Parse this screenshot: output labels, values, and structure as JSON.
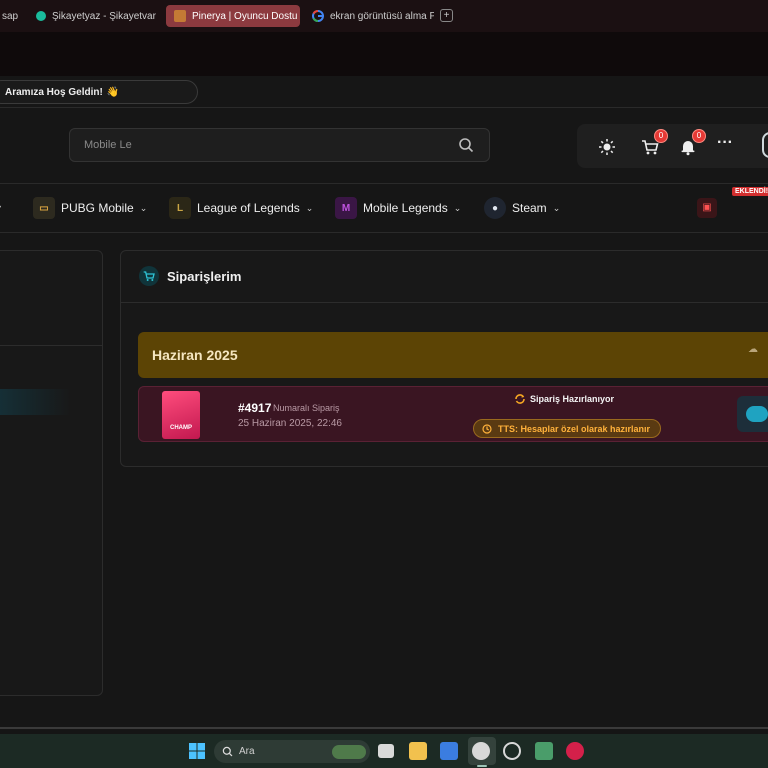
{
  "browser": {
    "tabs": [
      {
        "label": "sap"
      },
      {
        "label": "Şikayetyaz - Şikayetvar"
      },
      {
        "label": "Pinerya | Oyuncu Dostu",
        "active": true
      },
      {
        "label": "ekran görüntüsü alma PC"
      }
    ],
    "new_tab": "+"
  },
  "header": {
    "announcement": "Aramıza Hoş Geldin!",
    "announcement_emoji": "👋",
    "search_value": "Mobile Le",
    "cart_count": "0",
    "notification_count": "0",
    "more": "···"
  },
  "nav": {
    "items": [
      {
        "label": "PUBG Mobile",
        "icon": "pubg-icon"
      },
      {
        "label": "League of Legends",
        "icon": "lol-icon"
      },
      {
        "label": "Mobile Legends",
        "icon": "mobile-legends-icon"
      },
      {
        "label": "Steam",
        "icon": "steam-icon"
      }
    ],
    "new_badge": "EKLENDİ!"
  },
  "orders": {
    "title": "Siparişlerim",
    "month": "Haziran 2025",
    "order": {
      "number": "#4917",
      "number_label": "Numaralı Sipariş",
      "date": "25 Haziran 2025, 22:46",
      "thumb_text": "CHAMP",
      "status": "Sipariş Hazırlanıyor",
      "tts": "TTS: Hesaplar özel olarak hazırlanır"
    }
  },
  "taskbar": {
    "search_placeholder": "Ara"
  },
  "colors": {
    "accent_teal": "#1fa3c1",
    "month_bar": "#5c4405",
    "order_row": "#3a1522",
    "badge_red": "#e53935",
    "tts_orange": "#ffb13b"
  }
}
